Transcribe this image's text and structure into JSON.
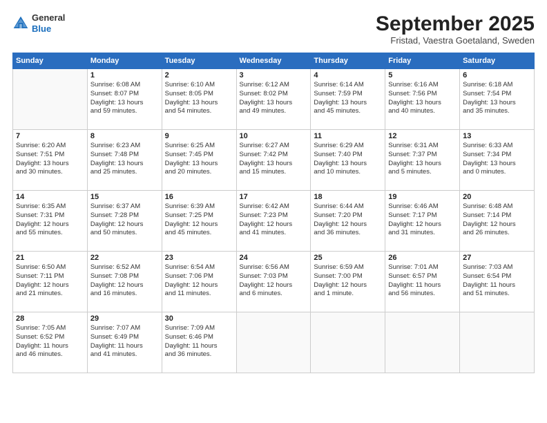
{
  "header": {
    "logo_line1": "General",
    "logo_line2": "Blue",
    "month": "September 2025",
    "location": "Fristad, Vaestra Goetaland, Sweden"
  },
  "days_of_week": [
    "Sunday",
    "Monday",
    "Tuesday",
    "Wednesday",
    "Thursday",
    "Friday",
    "Saturday"
  ],
  "weeks": [
    [
      {
        "day": "",
        "info": ""
      },
      {
        "day": "1",
        "info": "Sunrise: 6:08 AM\nSunset: 8:07 PM\nDaylight: 13 hours\nand 59 minutes."
      },
      {
        "day": "2",
        "info": "Sunrise: 6:10 AM\nSunset: 8:05 PM\nDaylight: 13 hours\nand 54 minutes."
      },
      {
        "day": "3",
        "info": "Sunrise: 6:12 AM\nSunset: 8:02 PM\nDaylight: 13 hours\nand 49 minutes."
      },
      {
        "day": "4",
        "info": "Sunrise: 6:14 AM\nSunset: 7:59 PM\nDaylight: 13 hours\nand 45 minutes."
      },
      {
        "day": "5",
        "info": "Sunrise: 6:16 AM\nSunset: 7:56 PM\nDaylight: 13 hours\nand 40 minutes."
      },
      {
        "day": "6",
        "info": "Sunrise: 6:18 AM\nSunset: 7:54 PM\nDaylight: 13 hours\nand 35 minutes."
      }
    ],
    [
      {
        "day": "7",
        "info": "Sunrise: 6:20 AM\nSunset: 7:51 PM\nDaylight: 13 hours\nand 30 minutes."
      },
      {
        "day": "8",
        "info": "Sunrise: 6:23 AM\nSunset: 7:48 PM\nDaylight: 13 hours\nand 25 minutes."
      },
      {
        "day": "9",
        "info": "Sunrise: 6:25 AM\nSunset: 7:45 PM\nDaylight: 13 hours\nand 20 minutes."
      },
      {
        "day": "10",
        "info": "Sunrise: 6:27 AM\nSunset: 7:42 PM\nDaylight: 13 hours\nand 15 minutes."
      },
      {
        "day": "11",
        "info": "Sunrise: 6:29 AM\nSunset: 7:40 PM\nDaylight: 13 hours\nand 10 minutes."
      },
      {
        "day": "12",
        "info": "Sunrise: 6:31 AM\nSunset: 7:37 PM\nDaylight: 13 hours\nand 5 minutes."
      },
      {
        "day": "13",
        "info": "Sunrise: 6:33 AM\nSunset: 7:34 PM\nDaylight: 13 hours\nand 0 minutes."
      }
    ],
    [
      {
        "day": "14",
        "info": "Sunrise: 6:35 AM\nSunset: 7:31 PM\nDaylight: 12 hours\nand 55 minutes."
      },
      {
        "day": "15",
        "info": "Sunrise: 6:37 AM\nSunset: 7:28 PM\nDaylight: 12 hours\nand 50 minutes."
      },
      {
        "day": "16",
        "info": "Sunrise: 6:39 AM\nSunset: 7:25 PM\nDaylight: 12 hours\nand 45 minutes."
      },
      {
        "day": "17",
        "info": "Sunrise: 6:42 AM\nSunset: 7:23 PM\nDaylight: 12 hours\nand 41 minutes."
      },
      {
        "day": "18",
        "info": "Sunrise: 6:44 AM\nSunset: 7:20 PM\nDaylight: 12 hours\nand 36 minutes."
      },
      {
        "day": "19",
        "info": "Sunrise: 6:46 AM\nSunset: 7:17 PM\nDaylight: 12 hours\nand 31 minutes."
      },
      {
        "day": "20",
        "info": "Sunrise: 6:48 AM\nSunset: 7:14 PM\nDaylight: 12 hours\nand 26 minutes."
      }
    ],
    [
      {
        "day": "21",
        "info": "Sunrise: 6:50 AM\nSunset: 7:11 PM\nDaylight: 12 hours\nand 21 minutes."
      },
      {
        "day": "22",
        "info": "Sunrise: 6:52 AM\nSunset: 7:08 PM\nDaylight: 12 hours\nand 16 minutes."
      },
      {
        "day": "23",
        "info": "Sunrise: 6:54 AM\nSunset: 7:06 PM\nDaylight: 12 hours\nand 11 minutes."
      },
      {
        "day": "24",
        "info": "Sunrise: 6:56 AM\nSunset: 7:03 PM\nDaylight: 12 hours\nand 6 minutes."
      },
      {
        "day": "25",
        "info": "Sunrise: 6:59 AM\nSunset: 7:00 PM\nDaylight: 12 hours\nand 1 minute."
      },
      {
        "day": "26",
        "info": "Sunrise: 7:01 AM\nSunset: 6:57 PM\nDaylight: 11 hours\nand 56 minutes."
      },
      {
        "day": "27",
        "info": "Sunrise: 7:03 AM\nSunset: 6:54 PM\nDaylight: 11 hours\nand 51 minutes."
      }
    ],
    [
      {
        "day": "28",
        "info": "Sunrise: 7:05 AM\nSunset: 6:52 PM\nDaylight: 11 hours\nand 46 minutes."
      },
      {
        "day": "29",
        "info": "Sunrise: 7:07 AM\nSunset: 6:49 PM\nDaylight: 11 hours\nand 41 minutes."
      },
      {
        "day": "30",
        "info": "Sunrise: 7:09 AM\nSunset: 6:46 PM\nDaylight: 11 hours\nand 36 minutes."
      },
      {
        "day": "",
        "info": ""
      },
      {
        "day": "",
        "info": ""
      },
      {
        "day": "",
        "info": ""
      },
      {
        "day": "",
        "info": ""
      }
    ]
  ]
}
